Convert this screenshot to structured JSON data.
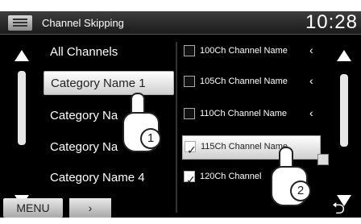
{
  "header": {
    "title": "Channel Skipping",
    "clock": "10:28"
  },
  "categories": [
    {
      "label": "All Channels",
      "selected": false
    },
    {
      "label": "Category Name 1",
      "selected": true
    },
    {
      "label": "Category Na",
      "selected": false
    },
    {
      "label": "Category Na",
      "selected": false
    },
    {
      "label": "Category Name 4",
      "selected": false
    }
  ],
  "channels": [
    {
      "label": "100Ch Channel Name",
      "checked": false,
      "selected": false
    },
    {
      "label": "105Ch Channel Name",
      "checked": false,
      "selected": false
    },
    {
      "label": "110Ch Channel Name",
      "checked": false,
      "selected": false
    },
    {
      "label": "115Ch Channel Name",
      "checked": true,
      "selected": true
    },
    {
      "label": "120Ch Channel",
      "checked": true,
      "selected": false
    }
  ],
  "footer": {
    "menu_label": "MENU",
    "next_label": "›",
    "back_label": "⮌"
  },
  "steps": {
    "one": "1",
    "two": "2"
  },
  "icons": {
    "chevron": "‹",
    "check": "✓"
  },
  "colors": {
    "selected_bg": "#ffffff",
    "screen_bg": "#000000"
  }
}
